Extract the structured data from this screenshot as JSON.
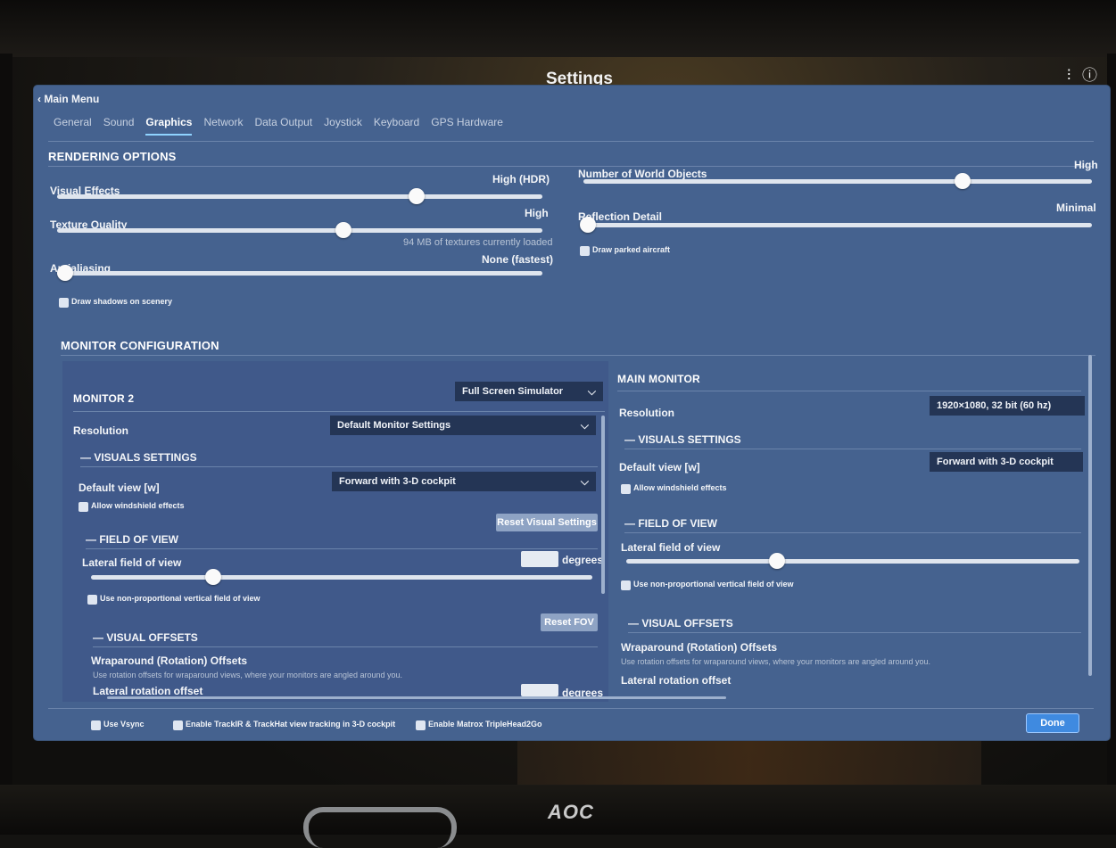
{
  "window": {
    "title": "Settings"
  },
  "header": {
    "back_label": "Main Menu"
  },
  "tabs": [
    "General",
    "Sound",
    "Graphics",
    "Network",
    "Data Output",
    "Joystick",
    "Keyboard",
    "GPS Hardware"
  ],
  "active_tab": "Graphics",
  "rendering": {
    "title": "RENDERING OPTIONS",
    "visual_effects": {
      "label": "Visual Effects",
      "value": "High (HDR)",
      "level": 0.74
    },
    "texture_quality": {
      "label": "Texture Quality",
      "value": "High",
      "level": 0.58,
      "note": "94 MB of textures currently loaded"
    },
    "antialiasing": {
      "label": "Antialiasing",
      "value": "None (fastest)",
      "level": 0.0
    },
    "draw_shadows": "Draw shadows on scenery",
    "world_objects": {
      "label": "Number of World Objects",
      "value": "High",
      "level": 0.75
    },
    "reflection_detail": {
      "label": "Reflection Detail",
      "value": "Minimal",
      "level": 0.0
    },
    "draw_parked": "Draw parked aircraft"
  },
  "monitor_config": {
    "title": "MONITOR CONFIGURATION",
    "monitor2": {
      "title": "MONITOR 2",
      "mode": "Full Screen Simulator",
      "resolution_label": "Resolution",
      "resolution_value": "Default Monitor Settings",
      "visuals_title": "— VISUALS SETTINGS",
      "default_view_label": "Default view [w]",
      "default_view_value": "Forward with 3-D cockpit",
      "windshield": "Allow windshield effects",
      "reset_visual": "Reset Visual Settings",
      "fov_title": "— FIELD OF VIEW",
      "lateral_fov_label": "Lateral field of view",
      "degrees": "degrees",
      "fov_level": 0.25,
      "nonprop": "Use non-proportional vertical field of view",
      "reset_fov": "Reset FOV",
      "offsets_title": "— VISUAL OFFSETS",
      "wraparound_title": "Wraparound (Rotation) Offsets",
      "wraparound_desc": "Use rotation offsets for wraparound views, where your monitors are angled around you.",
      "lateral_rot_label": "Lateral rotation offset",
      "lateral_rot_unit": "degrees"
    },
    "main": {
      "title": "MAIN MONITOR",
      "resolution_label": "Resolution",
      "resolution_value": "1920×1080, 32 bit (60 hz)",
      "visuals_title": "— VISUALS SETTINGS",
      "default_view_label": "Default view [w]",
      "default_view_value": "Forward with 3-D cockpit",
      "windshield": "Allow windshield effects",
      "fov_title": "— FIELD OF VIEW",
      "lateral_fov_label": "Lateral field of view",
      "fov_level": 0.33,
      "nonprop": "Use non-proportional vertical field of view",
      "offsets_title": "— VISUAL OFFSETS",
      "wraparound_title": "Wraparound (Rotation) Offsets",
      "wraparound_desc": "Use rotation offsets for wraparound views, where your monitors are angled around you.",
      "lateral_rot_label": "Lateral rotation offset"
    }
  },
  "footer": {
    "vsync": "Use Vsync",
    "trackir": "Enable TrackIR & TrackHat view tracking in 3-D cockpit",
    "matrox": "Enable Matrox TripleHead2Go",
    "done": "Done"
  },
  "hardware": {
    "brand": "AOC"
  }
}
